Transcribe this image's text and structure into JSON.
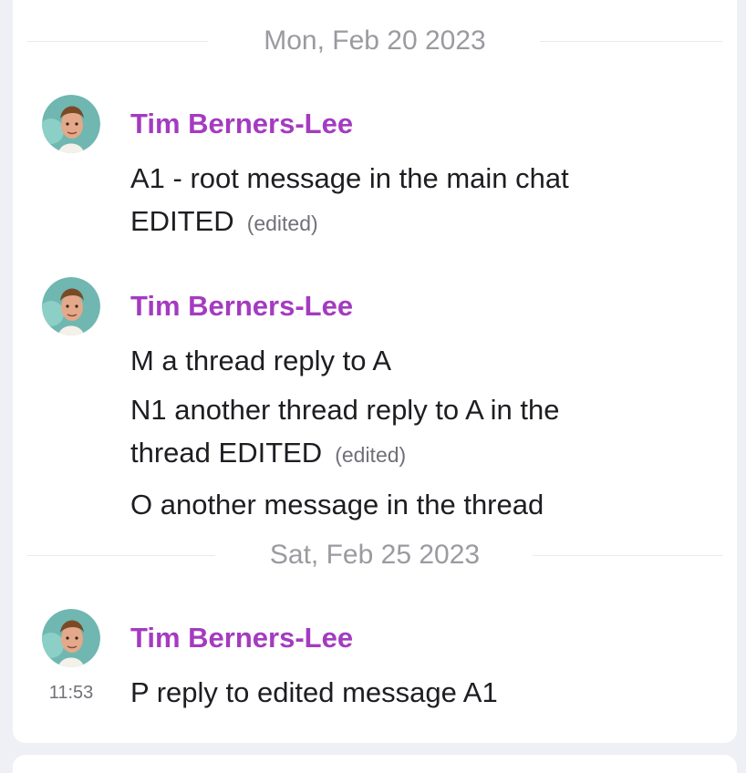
{
  "date_separators": [
    {
      "label": "Mon, Feb 20 2023"
    },
    {
      "label": "Sat, Feb 25 2023"
    }
  ],
  "groups": [
    {
      "author": "Tim Berners-Lee",
      "messages": [
        {
          "text": "A1 - root message in the main chat EDITED",
          "edited_label": "(edited)"
        }
      ]
    },
    {
      "author": "Tim Berners-Lee",
      "messages": [
        {
          "text": "M a thread reply to A"
        },
        {
          "text": "N1 another thread reply to A in the thread EDITED",
          "edited_label": "(edited)"
        },
        {
          "text": "O another message in the thread"
        }
      ]
    },
    {
      "author": "Tim Berners-Lee",
      "time": "11:53",
      "messages": [
        {
          "text": "P reply to edited message A1"
        }
      ]
    }
  ],
  "avatar_icon": "user-avatar-icon",
  "colors": {
    "author": "#a43bc0",
    "background": "#eff0f6",
    "panel": "#ffffff"
  }
}
